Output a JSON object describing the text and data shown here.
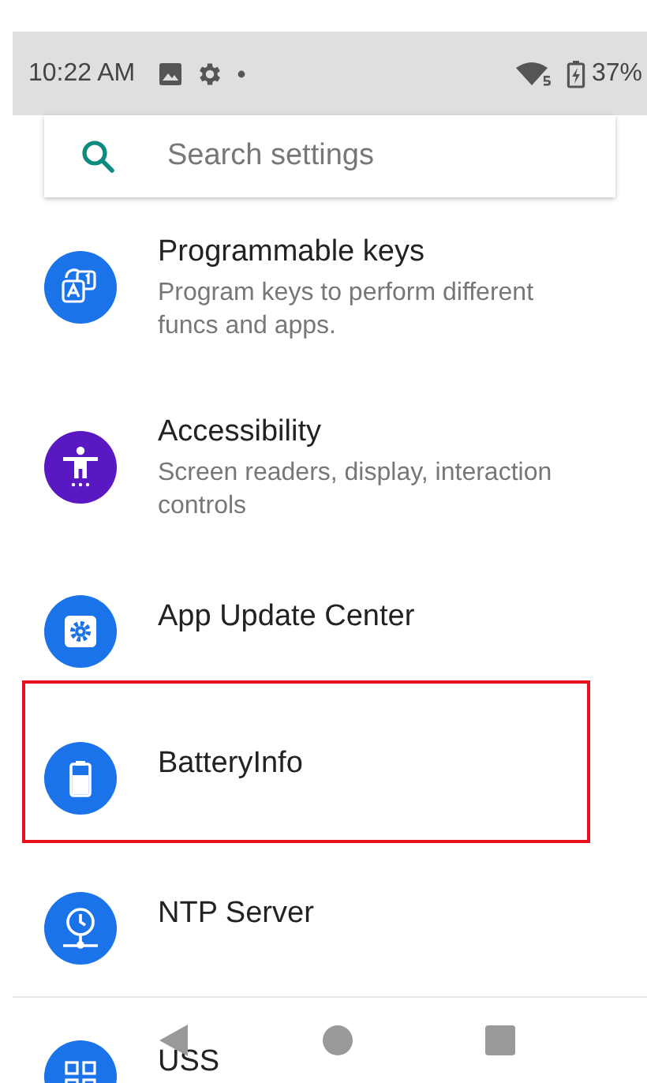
{
  "status_bar": {
    "time": "10:22 AM",
    "battery": "37%"
  },
  "search": {
    "placeholder": "Search settings"
  },
  "items": [
    {
      "kind": "keys",
      "title": "Programmable keys",
      "summary": "Program keys to perform different funcs and apps.",
      "color": "#1a73e8",
      "highlighted": false
    },
    {
      "kind": "accessibility",
      "title": "Accessibility",
      "summary": "Screen readers, display, interaction controls",
      "color": "#5a18c2",
      "highlighted": false
    },
    {
      "kind": "update",
      "title": "App Update Center",
      "color": "#1a73e8",
      "highlighted": false
    },
    {
      "kind": "battery",
      "title": "BatteryInfo",
      "color": "#1a73e8",
      "highlighted": true
    },
    {
      "kind": "ntp",
      "title": "NTP Server",
      "color": "#1a73e8",
      "highlighted": false
    },
    {
      "kind": "qr",
      "title": "USS",
      "color": "#1a73e8",
      "highlighted": false
    }
  ]
}
